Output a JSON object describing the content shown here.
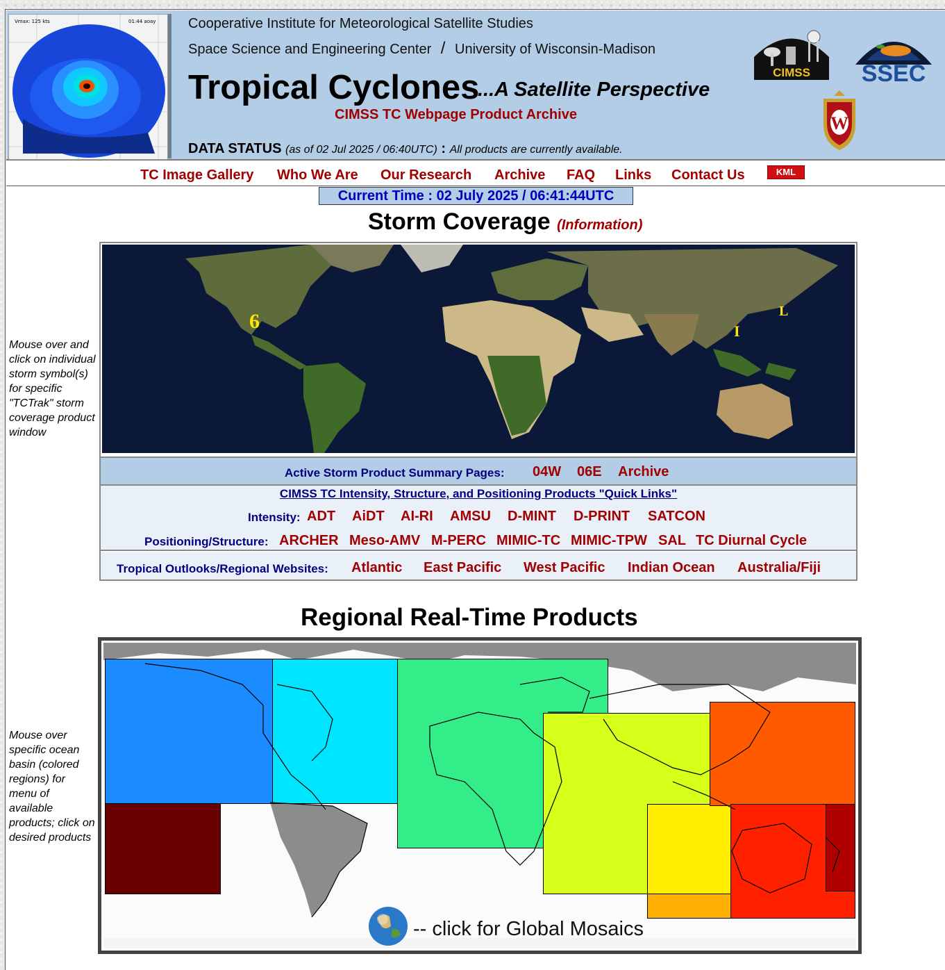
{
  "header": {
    "line1": "Cooperative Institute for Meteorological Satellite Studies",
    "line2a": "Space Science and Engineering Center",
    "line2sep": "/",
    "line2b": "University of Wisconsin-Madison",
    "title": "Tropical Cyclones",
    "subtitle": "...A Satellite Perspective",
    "archive_title": "CIMSS TC Webpage Product Archive",
    "thumb_label_left": "Vmax: 125 kts",
    "thumb_label_right": "01:44 aoay",
    "logo_cimss": "CIMSS",
    "logo_ssec": "SSEC",
    "logo_uw": "W"
  },
  "status": {
    "label": "DATA STATUS",
    "asof": "(as of 02 Jul 2025 / 06:40UTC)",
    "colon": ":",
    "message": "All products are currently available."
  },
  "nav": {
    "items": [
      "TC Image Gallery",
      "Who We Are",
      "Our Research",
      "Archive",
      "FAQ",
      "Links",
      "Contact Us"
    ],
    "kml": "KML"
  },
  "current_time": "Current Time : 02 July 2025 / 06:41:44UTC",
  "storm_coverage": {
    "heading": "Storm Coverage",
    "info": "(Information)",
    "side_note": "Mouse over and click on individual storm symbol(s) for specific \"TCTrak\" storm coverage product window",
    "storm_symbols": [
      "L"
    ],
    "active_label": "Active Storm Product Summary Pages:",
    "active_links": [
      "04W",
      "06E",
      "Archive"
    ],
    "quick_links": "CIMSS TC Intensity, Structure, and Positioning Products \"Quick Links\"",
    "intensity_label": "Intensity:",
    "intensity_links": [
      "ADT",
      "AiDT",
      "AI-RI",
      "AMSU",
      "D-MINT",
      "D-PRINT",
      "SATCON"
    ],
    "positioning_label": "Positioning/Structure:",
    "positioning_links": [
      "ARCHER",
      "Meso-AMV",
      "M-PERC",
      "MIMIC-TC",
      "MIMIC-TPW",
      "SAL",
      "TC Diurnal Cycle"
    ],
    "outlooks_label": "Tropical Outlooks/Regional Websites:",
    "outlooks_links": [
      "Atlantic",
      "East Pacific",
      "West Pacific",
      "Indian Ocean",
      "Australia/Fiji"
    ]
  },
  "regional": {
    "heading": "Regional Real-Time Products",
    "side_note": "Mouse over specific ocean basin (colored regions) for menu of available products; click on desired products",
    "mosaic_text": "-- click for Global Mosaics",
    "basin_colors": {
      "east_pacific": "#1a8cff",
      "atlantic_west": "#00e5ff",
      "atlantic_east": "#33ee88",
      "south_atlantic": "#6b0000",
      "indian_north": "#d6ff1a",
      "indian_south": "#ffee00",
      "indian_se": "#ffb000",
      "west_pacific": "#ff5a00",
      "australia": "#ff2000",
      "south_pacific": "#b00000"
    }
  }
}
